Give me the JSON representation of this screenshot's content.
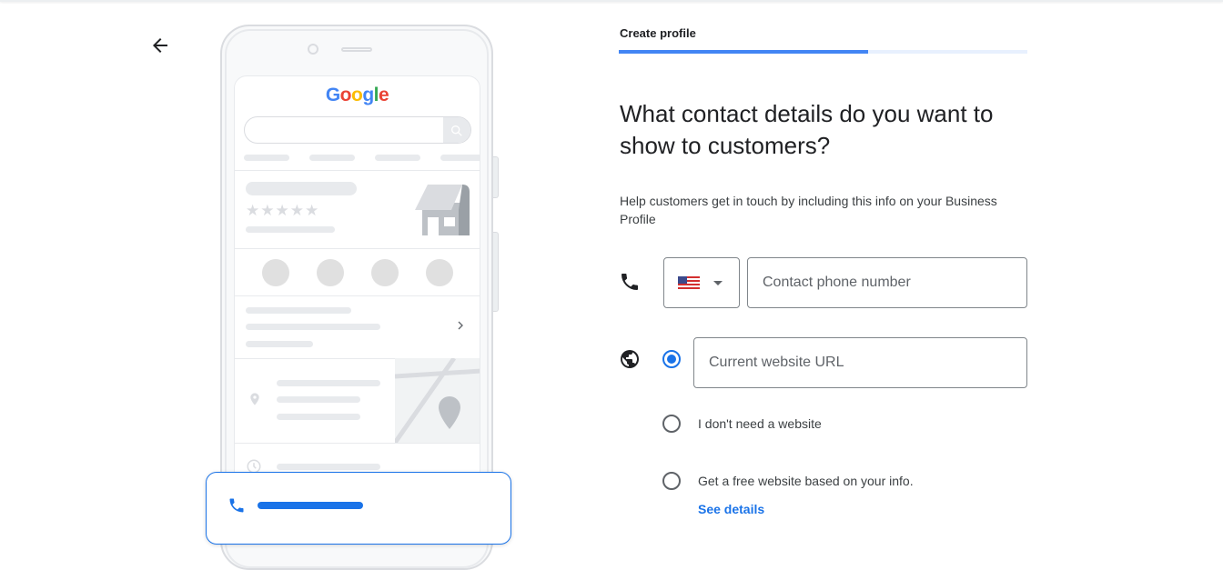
{
  "header": {
    "step_title": "Create profile",
    "progress_percent": 61
  },
  "illustration": {
    "logo_letters": [
      {
        "ch": "G",
        "color": "#4285f4"
      },
      {
        "ch": "o",
        "color": "#ea4335"
      },
      {
        "ch": "o",
        "color": "#fbbc05"
      },
      {
        "ch": "g",
        "color": "#4285f4"
      },
      {
        "ch": "l",
        "color": "#34a853"
      },
      {
        "ch": "e",
        "color": "#ea4335"
      }
    ]
  },
  "main": {
    "title": "What contact details do you want to show to customers?",
    "help": "Help customers get in touch by including this info on your Business Profile",
    "phone": {
      "country": "US",
      "placeholder": "Contact phone number",
      "value": ""
    },
    "website": {
      "placeholder": "Current website URL",
      "value": ""
    },
    "options": [
      {
        "label": "",
        "selected": true
      },
      {
        "label": "I don't need a website",
        "selected": false
      },
      {
        "label": "Get a free website based on your info.",
        "selected": false
      }
    ],
    "see_details": "See details"
  },
  "colors": {
    "accent": "#1a73e8",
    "progress_track": "#e8f0fe"
  }
}
